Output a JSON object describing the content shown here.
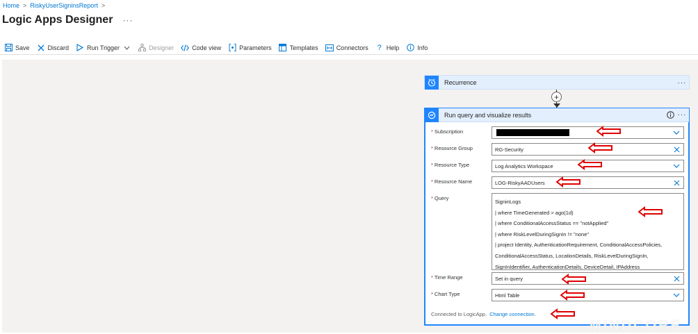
{
  "breadcrumb": {
    "home": "Home",
    "current": "RiskyUserSigninsReport",
    "sep": ">"
  },
  "page": {
    "title": "Logic Apps Designer",
    "more": "···"
  },
  "toolbar": {
    "save": "Save",
    "discard": "Discard",
    "run_trigger": "Run Trigger",
    "designer": "Designer",
    "code_view": "Code view",
    "parameters": "Parameters",
    "templates": "Templates",
    "connectors": "Connectors",
    "help": "Help",
    "info": "Info"
  },
  "recurrence": {
    "title": "Recurrence",
    "more": "···"
  },
  "action": {
    "title": "Run query and visualize results",
    "more": "···",
    "fields": {
      "subscription": {
        "label": "Subscription",
        "value": ""
      },
      "resource_group": {
        "label": "Resource Group",
        "value": "RG-Security"
      },
      "resource_type": {
        "label": "Resource Type",
        "value": "Log Analytics Workspace"
      },
      "resource_name": {
        "label": "Resource Name",
        "value": "LOG-RiskyAADUsers"
      },
      "query": {
        "label": "Query",
        "lines": [
          "SigninLogs",
          "| where TimeGenerated > ago(1d)",
          "| where ConditionalAccessStatus == \"notApplied\"",
          "| where RiskLevelDuringSignIn != \"none\"",
          "| project Identity, AuthenticationRequirement, ConditionalAccessPolicies,",
          "ConditionalAccessStatus, LocationDetails, RiskLevelDuringSignIn,",
          "SignInIdentifier, AuthenticationDetails, DeviceDetail, IPAddress"
        ]
      },
      "time_range": {
        "label": "Time Range",
        "value": "Set in query"
      },
      "chart_type": {
        "label": "Chart Type",
        "value": "Html Table"
      }
    },
    "required_mark": "*",
    "footer": {
      "connected": "Connected to LogicApp.",
      "change": "Change connection."
    }
  },
  "watermark": "MINDCORE",
  "colors": {
    "accent": "#0078d4",
    "header_blue": "#1f85ff",
    "annotation_red": "#e00000"
  }
}
